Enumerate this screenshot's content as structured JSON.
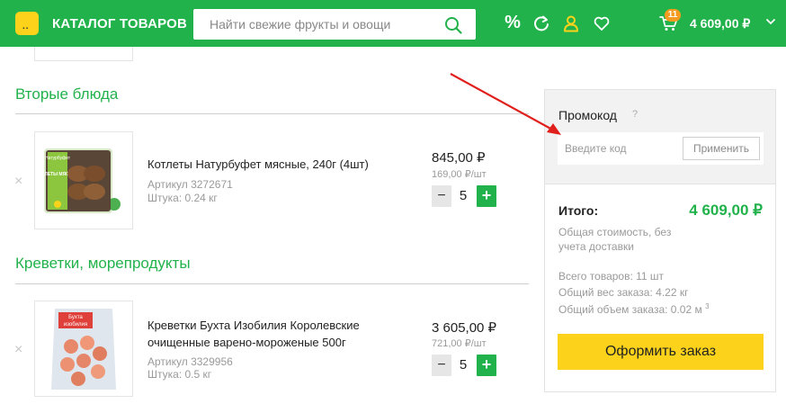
{
  "header": {
    "logo_text": "..",
    "catalog_label": "КАТАЛОГ ТОВАРОВ",
    "search_placeholder": "Найти свежие фрукты и овощи",
    "discount_label": "%",
    "cart_count": "11",
    "cart_total": "4 609,00 ₽",
    "accent_color": "#22b24c",
    "brand_yellow": "#fcd31a"
  },
  "sections": [
    {
      "title": "Вторые блюда",
      "item": {
        "remove": "×",
        "name": "Котлеты Натурбуфет мясные, 240г (4шт)",
        "article": "Артикул 3272671",
        "weight": "Штука: 0.24 кг",
        "price": "845,00 ₽",
        "unit_price": "169,00 ₽/шт",
        "qty": "5",
        "image_label_top": "Натурбуфет",
        "image_label": "КОТЛЕТЫ МЯСНЫЕ"
      }
    },
    {
      "title": "Креветки, морепродукты",
      "item": {
        "remove": "×",
        "name_line1": "Креветки Бухта Изобилия Королевские",
        "name_line2": "очищенные варено-мороженые 500г",
        "article": "Артикул 3329956",
        "weight": "Штука: 0.5 кг",
        "price": "3 605,00 ₽",
        "unit_price": "721,00 ₽/шт",
        "qty": "5",
        "image_label_top": "Бухта",
        "image_label": "изобилия"
      }
    }
  ],
  "stepper": {
    "minus": "−",
    "plus": "+"
  },
  "promo": {
    "title": "Промокод",
    "help": "?",
    "placeholder": "Введите код",
    "apply_label": "Применить"
  },
  "summary": {
    "total_label": "Итого:",
    "total_value": "4 609,00 ₽",
    "note": "Общая стоимость, без учета доставки",
    "items_count": "Всего товаров: 11 шт",
    "weight": "Общий вес заказа: 4.22 кг",
    "volume": "Общий объем заказа: 0.02 м",
    "volume_sup": "3",
    "checkout_label": "Оформить заказ"
  },
  "icons": [
    "logo-icon",
    "search-icon",
    "percent-icon",
    "refresh-icon",
    "user-icon",
    "heart-icon",
    "cart-icon",
    "chevron-down-icon",
    "close-icon",
    "minus-icon",
    "plus-icon",
    "arrow-annotation"
  ]
}
